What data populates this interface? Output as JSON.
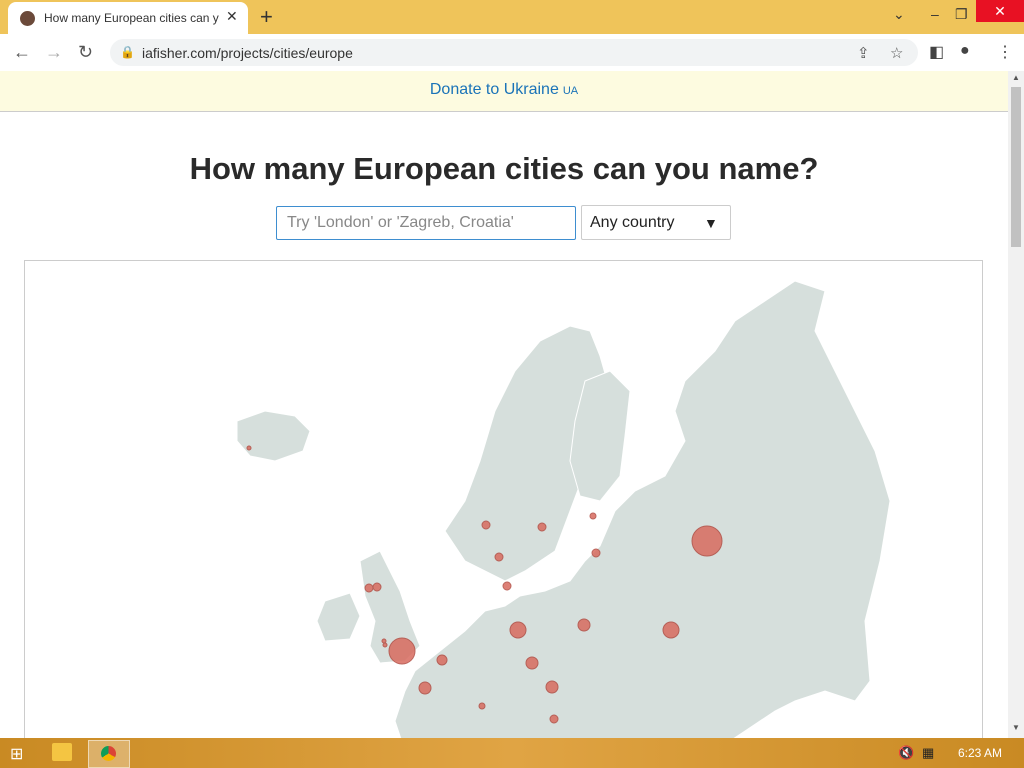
{
  "browser": {
    "tab_title": "How many European cities can you name?",
    "new_tab": "+",
    "url": "iafisher.com/projects/cities/europe"
  },
  "page": {
    "banner_text": "Donate to Ukraine",
    "banner_country_code": "UA",
    "heading": "How many European cities can you name?",
    "input_placeholder": "Try 'London' or 'Zagreb, Croatia'",
    "country_select": "Any country"
  },
  "map": {
    "land_color": "#d6dfdc",
    "marker_color": "#d86b5f"
  },
  "taskbar": {
    "clock": "6:23 AM"
  }
}
